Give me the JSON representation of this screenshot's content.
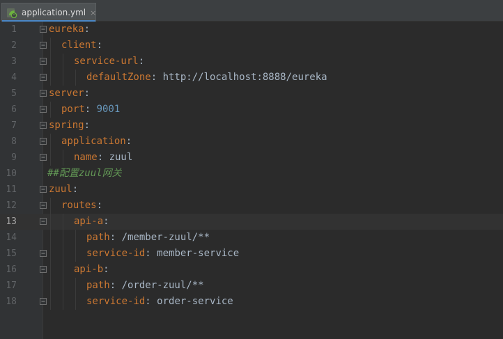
{
  "tab": {
    "label": "application.yml",
    "close": "×",
    "icon": "spring-leaf-icon"
  },
  "colors": {
    "key": "#cc7832",
    "value": "#a9b7c6",
    "number": "#6897bb",
    "comment": "#629755",
    "line_number": "#606366",
    "background": "#2b2b2b"
  },
  "editor": {
    "current_line": 13,
    "lines": [
      {
        "num": "1",
        "indent": 0,
        "fold": "open",
        "key": "eureka",
        "sep": ":",
        "value": "",
        "vtype": ""
      },
      {
        "num": "2",
        "indent": 1,
        "fold": "open",
        "key": "client",
        "sep": ":",
        "value": "",
        "vtype": ""
      },
      {
        "num": "3",
        "indent": 2,
        "fold": "open",
        "key": "service-url",
        "sep": ":",
        "value": "",
        "vtype": ""
      },
      {
        "num": "4",
        "indent": 3,
        "fold": "end",
        "key": "defaultZone",
        "sep": ": ",
        "value": "http://localhost:8888/eureka",
        "vtype": "str"
      },
      {
        "num": "5",
        "indent": 0,
        "fold": "open",
        "key": "server",
        "sep": ":",
        "value": "",
        "vtype": ""
      },
      {
        "num": "6",
        "indent": 1,
        "fold": "end",
        "key": "port",
        "sep": ": ",
        "value": "9001",
        "vtype": "num"
      },
      {
        "num": "7",
        "indent": 0,
        "fold": "open",
        "key": "spring",
        "sep": ":",
        "value": "",
        "vtype": ""
      },
      {
        "num": "8",
        "indent": 1,
        "fold": "open",
        "key": "application",
        "sep": ":",
        "value": "",
        "vtype": ""
      },
      {
        "num": "9",
        "indent": 2,
        "fold": "end",
        "key": "name",
        "sep": ": ",
        "value": "zuul",
        "vtype": "str"
      },
      {
        "num": "10",
        "indent": 0,
        "fold": "",
        "comment": "##配置zuul网关"
      },
      {
        "num": "11",
        "indent": 0,
        "fold": "open",
        "key": "zuul",
        "sep": ":",
        "value": "",
        "vtype": ""
      },
      {
        "num": "12",
        "indent": 1,
        "fold": "open",
        "key": "routes",
        "sep": ":",
        "value": "",
        "vtype": ""
      },
      {
        "num": "13",
        "indent": 2,
        "fold": "open",
        "key": "api-a",
        "sep": ":",
        "value": "",
        "vtype": ""
      },
      {
        "num": "14",
        "indent": 3,
        "fold": "",
        "key": "path",
        "sep": ": ",
        "value": "/member-zuul/**",
        "vtype": "str"
      },
      {
        "num": "15",
        "indent": 3,
        "fold": "end",
        "key": "service-id",
        "sep": ": ",
        "value": "member-service",
        "vtype": "str"
      },
      {
        "num": "16",
        "indent": 2,
        "fold": "open",
        "key": "api-b",
        "sep": ":",
        "value": "",
        "vtype": ""
      },
      {
        "num": "17",
        "indent": 3,
        "fold": "",
        "key": "path",
        "sep": ": ",
        "value": "/order-zuul/**",
        "vtype": "str"
      },
      {
        "num": "18",
        "indent": 3,
        "fold": "end",
        "key": "service-id",
        "sep": ": ",
        "value": "order-service",
        "vtype": "str"
      }
    ]
  }
}
